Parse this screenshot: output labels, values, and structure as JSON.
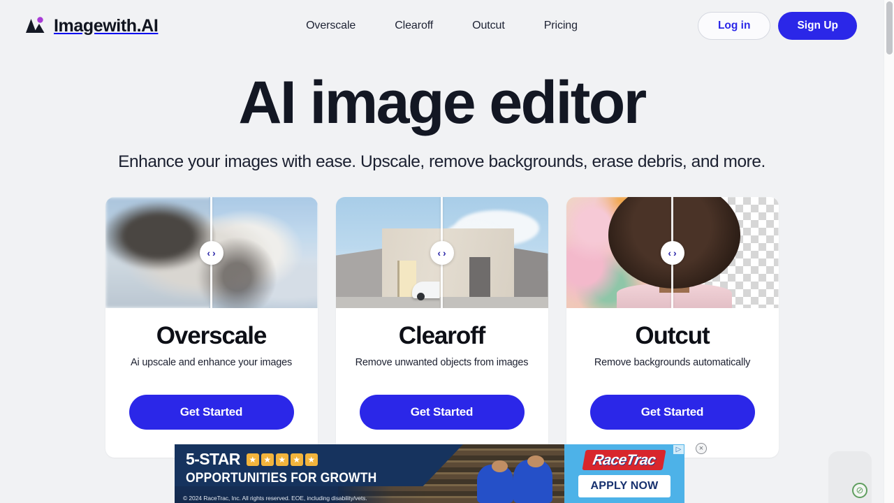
{
  "header": {
    "brand": "Imagewith.AI",
    "brand_icon": "mountain-logo-icon",
    "nav": [
      {
        "label": "Overscale"
      },
      {
        "label": "Clearoff"
      },
      {
        "label": "Outcut"
      },
      {
        "label": "Pricing"
      }
    ],
    "login_label": "Log in",
    "signup_label": "Sign Up"
  },
  "hero": {
    "title": "AI image editor",
    "subtitle": "Enhance your images with ease. Upscale, remove backgrounds, erase debris, and more."
  },
  "cards": [
    {
      "title": "Overscale",
      "subtitle": "Ai upscale and enhance your images",
      "cta": "Get Started",
      "media_alt": "before-after white lion upscale comparison",
      "handle_left": "‹",
      "handle_right": "›"
    },
    {
      "title": "Clearoff",
      "subtitle": "Remove unwanted objects from images",
      "cta": "Get Started",
      "media_alt": "before-after building with car removed comparison",
      "handle_left": "‹",
      "handle_right": "›"
    },
    {
      "title": "Outcut",
      "subtitle": "Remove backgrounds automatically",
      "cta": "Get Started",
      "media_alt": "before-after portrait background removal comparison",
      "handle_left": "‹",
      "handle_right": "›"
    }
  ],
  "ad": {
    "headline": "5-STAR",
    "subheadline": "OPPORTUNITIES FOR GROWTH",
    "legal": "© 2024 RaceTrac, Inc. All rights reserved. EOE, including disability/vets.",
    "brand": "RaceTrac",
    "cta": "APPLY NOW",
    "stars": [
      "★",
      "★",
      "★",
      "★",
      "★"
    ],
    "adchoices_label": "▷",
    "close_label": "×"
  },
  "widgets": {
    "green_badge": "⊘"
  },
  "colors": {
    "accent_blue": "#2b27e8",
    "page_bg": "#f1f2f4",
    "card_bg": "#ffffff",
    "text_dark": "#10141f",
    "ad_navy": "#13294c",
    "ad_blue": "#4db2e8",
    "ad_red": "#d8262c",
    "star_gold": "#f2b43c"
  }
}
